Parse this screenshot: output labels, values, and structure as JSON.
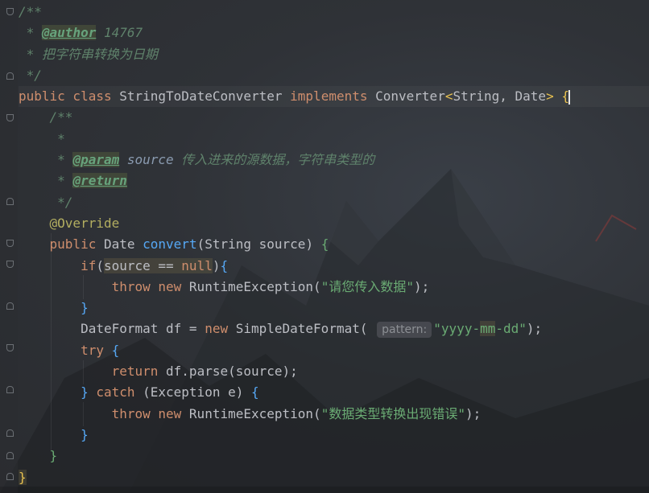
{
  "editor": {
    "lines": [
      {
        "parts": [
          [
            "doc",
            "/**"
          ]
        ]
      },
      {
        "parts": [
          [
            "doc",
            " * "
          ],
          [
            "tag",
            "@author"
          ],
          [
            "doc",
            " 14767"
          ]
        ]
      },
      {
        "parts": [
          [
            "doc",
            " * 把字符串转换为日期"
          ]
        ]
      },
      {
        "parts": [
          [
            "doc",
            " */"
          ]
        ]
      },
      {
        "current": true,
        "parts": [
          [
            "kw",
            "public class "
          ],
          [
            "cls",
            "StringToDateConverter "
          ],
          [
            "kw",
            "implements "
          ],
          [
            "cls",
            "Converter"
          ],
          [
            "brace-y",
            "<"
          ],
          [
            "cls",
            "String, Date"
          ],
          [
            "brace-y",
            "> {"
          ],
          [
            "caret",
            ""
          ]
        ]
      },
      {
        "parts": [
          [
            "doc",
            "    /**"
          ]
        ]
      },
      {
        "parts": [
          [
            "doc",
            "     *"
          ]
        ]
      },
      {
        "parts": [
          [
            "doc",
            "     * "
          ],
          [
            "tag",
            "@param"
          ],
          [
            "doc",
            " "
          ],
          [
            "param",
            "source"
          ],
          [
            "doc",
            " 传入进来的源数据，字符串类型的"
          ]
        ]
      },
      {
        "parts": [
          [
            "doc",
            "     * "
          ],
          [
            "tag",
            "@return"
          ]
        ]
      },
      {
        "parts": [
          [
            "doc",
            "     */"
          ]
        ]
      },
      {
        "parts": [
          [
            "ann",
            "    @Override"
          ]
        ]
      },
      {
        "parts": [
          [
            "kw",
            "    public "
          ],
          [
            "cls",
            "Date "
          ],
          [
            "fn",
            "convert"
          ],
          [
            "cls",
            "(String source) "
          ],
          [
            "brace-g",
            "{"
          ]
        ]
      },
      {
        "parts": [
          [
            "kw",
            "        if"
          ],
          [
            "cls",
            "("
          ],
          [
            "hl",
            "source == "
          ],
          [
            "kw-hl",
            "null"
          ],
          [
            "cls",
            ")"
          ],
          [
            "brace-b",
            "{"
          ]
        ]
      },
      {
        "parts": [
          [
            "kw",
            "            throw new "
          ],
          [
            "cls",
            "RuntimeException("
          ],
          [
            "str",
            "\"请您传入数据\""
          ],
          [
            "cls",
            ");"
          ]
        ]
      },
      {
        "parts": [
          [
            "brace-b",
            "        }"
          ]
        ]
      },
      {
        "parts": [
          [
            "cls",
            "        DateFormat df = "
          ],
          [
            "kw",
            "new "
          ],
          [
            "cls",
            "SimpleDateFormat( "
          ],
          [
            "hint",
            "pattern:"
          ],
          [
            "str",
            "\"yyyy-"
          ],
          [
            "str-hl",
            "mm"
          ],
          [
            "str",
            "-dd\""
          ],
          [
            "cls",
            ");"
          ]
        ]
      },
      {
        "parts": [
          [
            "kw",
            "        try "
          ],
          [
            "brace-b",
            "{"
          ]
        ]
      },
      {
        "parts": [
          [
            "kw",
            "            return "
          ],
          [
            "cls",
            "df.parse(source);"
          ]
        ]
      },
      {
        "parts": [
          [
            "brace-b",
            "        } "
          ],
          [
            "kw",
            "catch "
          ],
          [
            "cls",
            "(Exception e) "
          ],
          [
            "brace-b",
            "{"
          ]
        ]
      },
      {
        "parts": [
          [
            "kw",
            "            throw new "
          ],
          [
            "cls",
            "RuntimeException("
          ],
          [
            "str",
            "\"数据类型转换出现错误\""
          ],
          [
            "cls",
            ");"
          ]
        ]
      },
      {
        "parts": [
          [
            "brace-b",
            "        }"
          ]
        ]
      },
      {
        "parts": [
          [
            "brace-g",
            "    }"
          ]
        ]
      },
      {
        "parts": [
          [
            "brace-y-hl",
            "}"
          ]
        ]
      }
    ]
  }
}
